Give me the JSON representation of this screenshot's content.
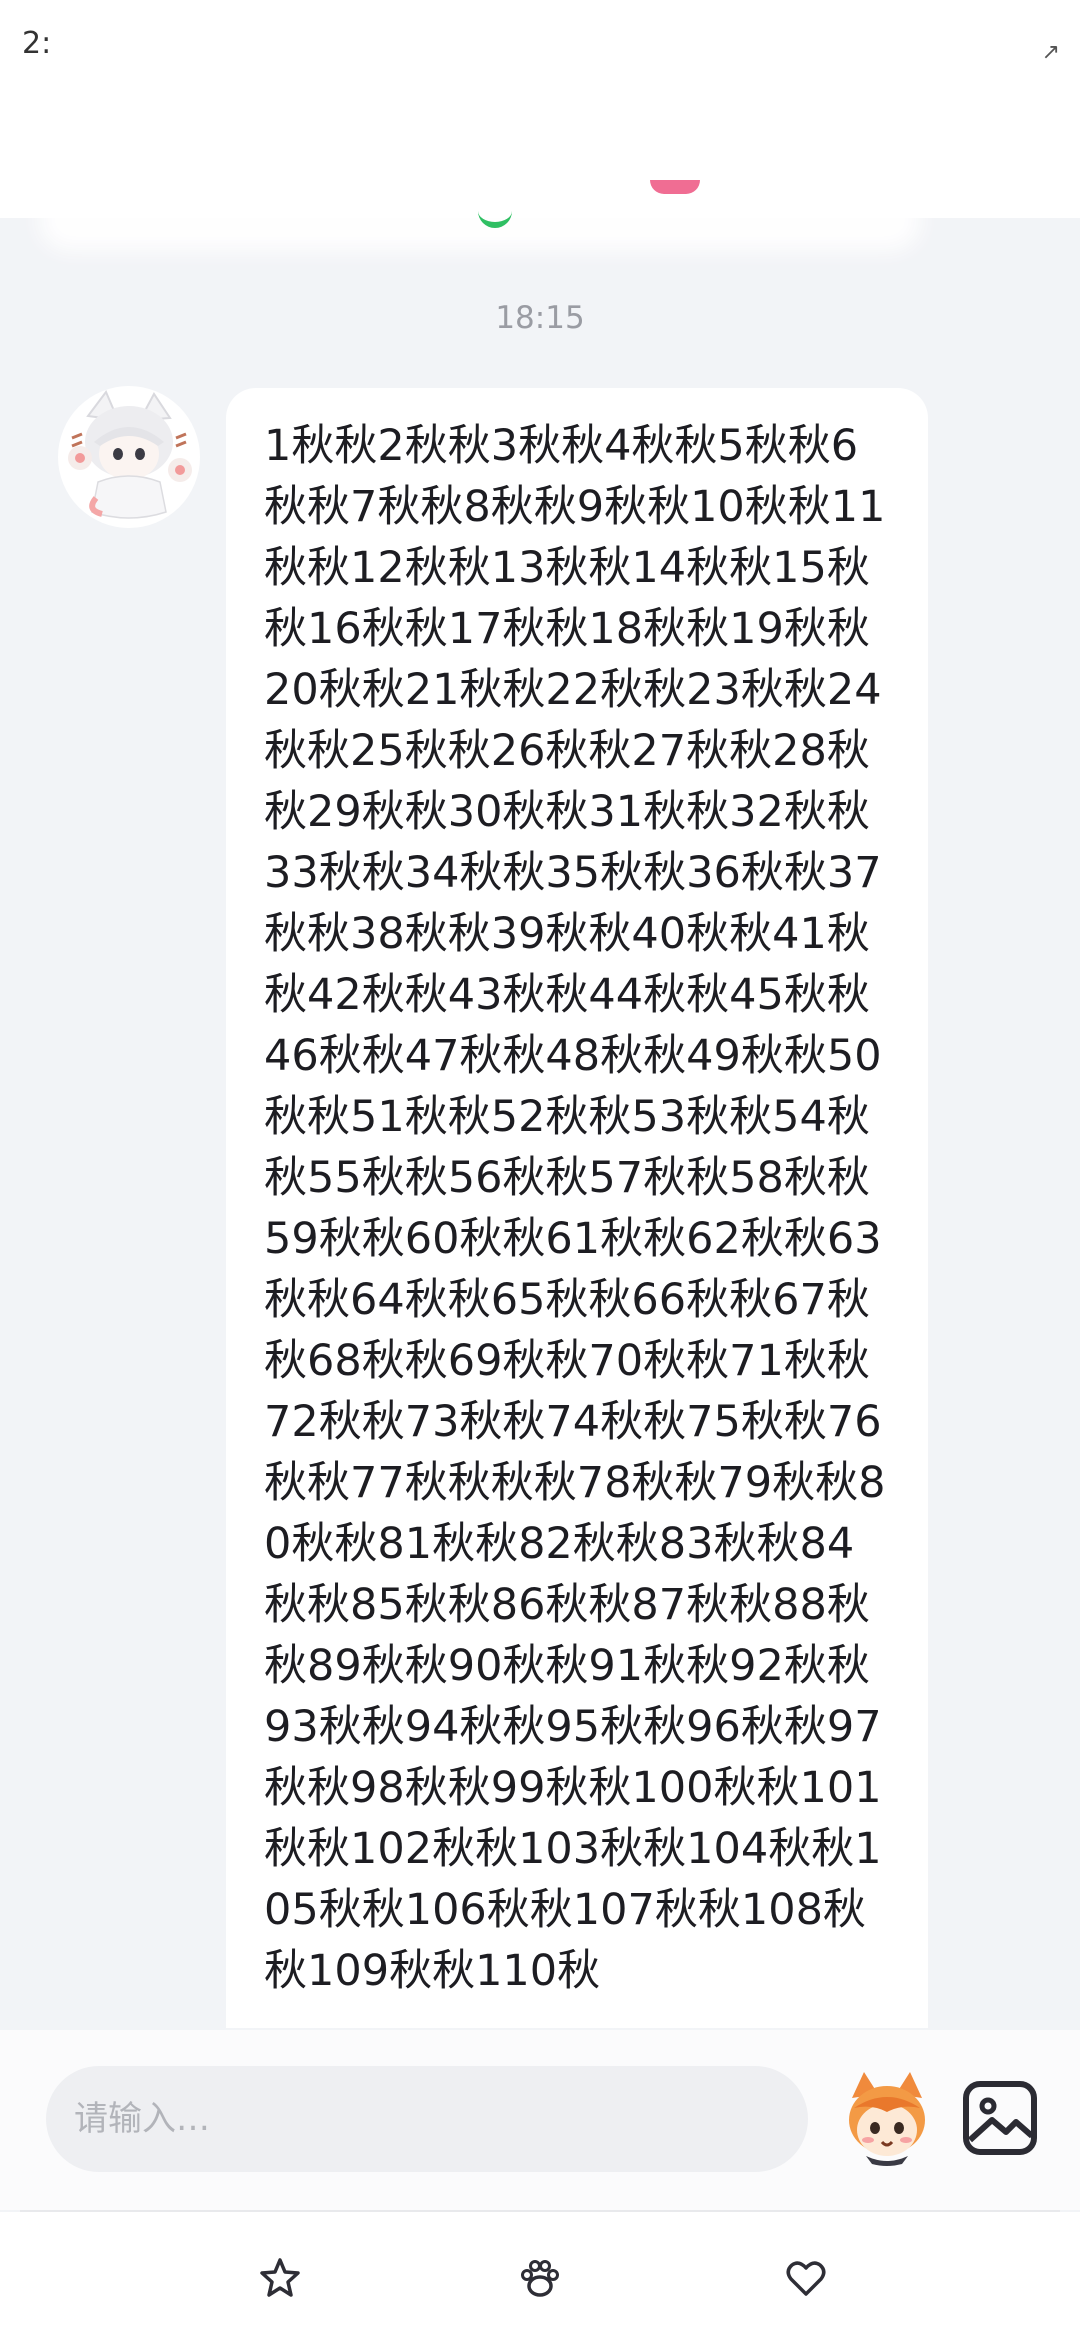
{
  "status_bar": {
    "time": "2:",
    "right": "↗"
  },
  "chat": {
    "timestamp": "18:15",
    "message": "1秋秋2秋秋3秋秋4秋秋5秋秋6秋秋7秋秋8秋秋9秋秋10秋秋11秋秋12秋秋13秋秋14秋秋15秋秋16秋秋17秋秋18秋秋19秋秋20秋秋21秋秋22秋秋23秋秋24秋秋25秋秋26秋秋27秋秋28秋秋29秋秋30秋秋31秋秋32秋秋33秋秋34秋秋35秋秋36秋秋37秋秋38秋秋39秋秋40秋秋41秋秋42秋秋43秋秋44秋秋45秋秋46秋秋47秋秋48秋秋49秋秋50秋秋51秋秋52秋秋53秋秋54秋秋55秋秋56秋秋57秋秋58秋秋59秋秋60秋秋61秋秋62秋秋63秋秋64秋秋65秋秋66秋秋67秋秋68秋秋69秋秋70秋秋71秋秋72秋秋73秋秋74秋秋75秋秋76秋秋77秋秋秋秋78秋秋79秋秋80秋秋81秋秋82秋秋83秋秋84秋秋85秋秋86秋秋87秋秋88秋秋89秋秋90秋秋91秋秋92秋秋93秋秋94秋秋95秋秋96秋秋97秋秋98秋秋99秋秋100秋秋101秋秋102秋秋103秋秋104秋秋105秋秋106秋秋107秋秋108秋秋109秋秋110秋"
  },
  "input": {
    "placeholder": "请输入…"
  },
  "icons": {
    "sticker": "sticker-icon",
    "image": "image-icon",
    "nav": [
      "star-icon",
      "paw-icon",
      "heart-icon"
    ]
  },
  "colors": {
    "background": "#f2f4f7",
    "bubble": "#ffffff",
    "input_bg": "#eeeff2",
    "accent_green": "#2fbf63",
    "accent_pink": "#ee5d87"
  }
}
